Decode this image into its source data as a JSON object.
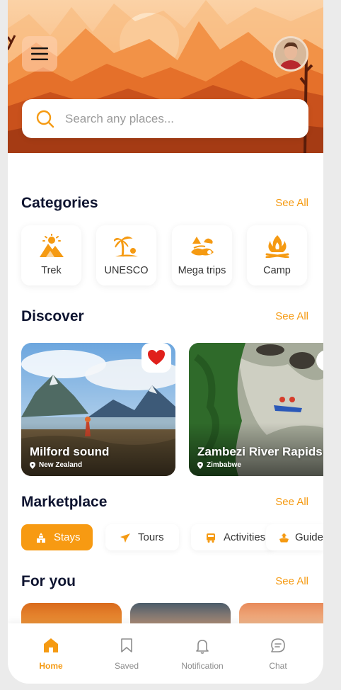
{
  "colors": {
    "accent": "#f59a12",
    "title": "#0e1430",
    "favorite": "#e0201b"
  },
  "search": {
    "placeholder": "Search any places..."
  },
  "icons": {
    "menu": "hamburger-menu-icon",
    "search": "search-icon",
    "favorite": "heart-icon"
  },
  "categories": {
    "title": "Categories",
    "see_all": "See All",
    "items": [
      {
        "label": "Trek",
        "icon": "mountain-sun-icon"
      },
      {
        "label": "UNESCO",
        "icon": "palm-tree-icon"
      },
      {
        "label": "Mega trips",
        "icon": "island-trip-icon"
      },
      {
        "label": "Camp",
        "icon": "campfire-icon"
      }
    ]
  },
  "discover": {
    "title": "Discover",
    "see_all": "See All",
    "items": [
      {
        "name": "Milford sound",
        "location": "New Zealand",
        "favorited": true
      },
      {
        "name": "Zambezi River Rapids",
        "location": "Zimbabwe",
        "favorited": false
      }
    ]
  },
  "marketplace": {
    "title": "Marketplace",
    "see_all": "See All",
    "items": [
      {
        "label": "Stays",
        "icon": "hotel-icon",
        "active": true
      },
      {
        "label": "Tours",
        "icon": "plane-icon",
        "active": false
      },
      {
        "label": "Activities",
        "icon": "bus-icon",
        "active": false
      },
      {
        "label": "Guide",
        "icon": "guide-icon",
        "active": false
      }
    ]
  },
  "for_you": {
    "title": "For you",
    "see_all": "See All"
  },
  "tabbar": [
    {
      "label": "Home",
      "icon": "home-icon",
      "active": true
    },
    {
      "label": "Saved",
      "icon": "bookmark-icon",
      "active": false
    },
    {
      "label": "Notification",
      "icon": "bell-icon",
      "active": false
    },
    {
      "label": "Chat",
      "icon": "chat-icon",
      "active": false
    }
  ]
}
